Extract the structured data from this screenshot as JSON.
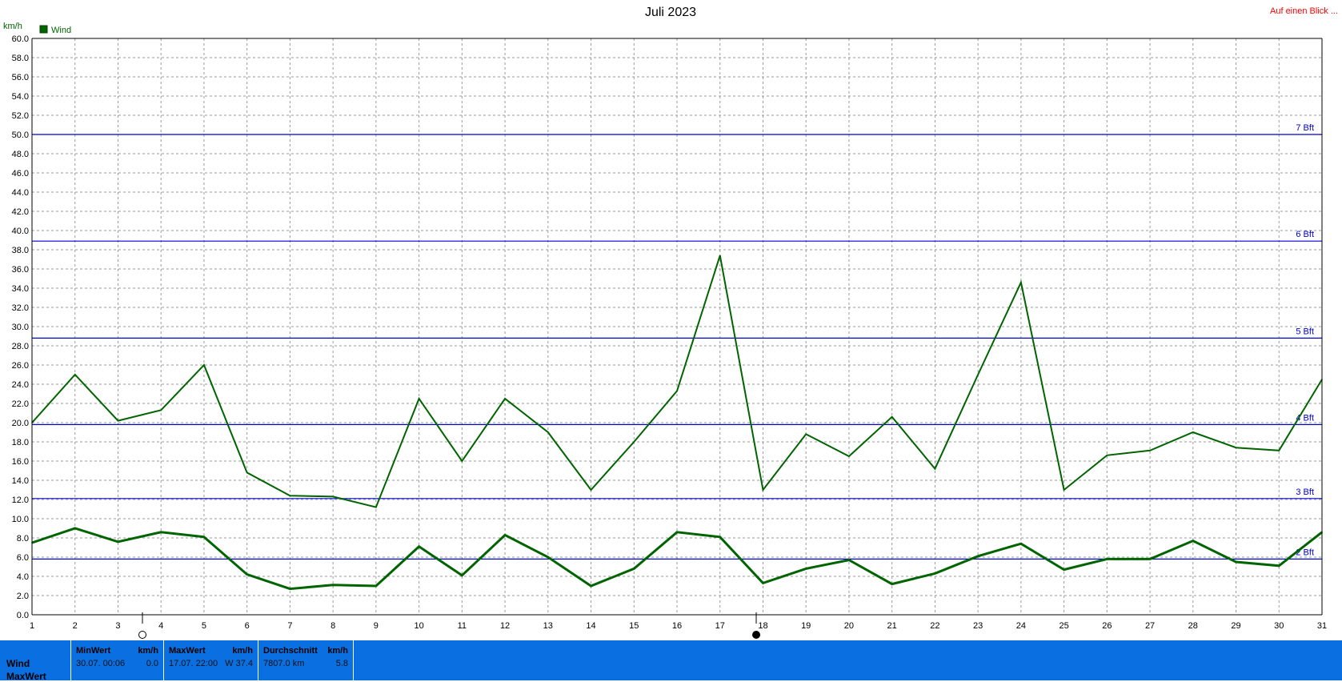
{
  "chart_data": {
    "type": "line",
    "title": "Juli 2023",
    "ylabel": "km/h",
    "ylim": [
      0,
      60
    ],
    "yticks": [
      "0.0",
      "2.0",
      "4.0",
      "6.0",
      "8.0",
      "10.0",
      "12.0",
      "14.0",
      "16.0",
      "18.0",
      "20.0",
      "22.0",
      "24.0",
      "26.0",
      "28.0",
      "30.0",
      "32.0",
      "34.0",
      "36.0",
      "38.0",
      "40.0",
      "42.0",
      "44.0",
      "46.0",
      "48.0",
      "50.0",
      "52.0",
      "54.0",
      "56.0",
      "58.0",
      "60.0"
    ],
    "x": [
      1,
      2,
      3,
      4,
      5,
      6,
      7,
      8,
      9,
      10,
      11,
      12,
      13,
      14,
      15,
      16,
      17,
      18,
      19,
      20,
      21,
      22,
      23,
      24,
      25,
      26,
      27,
      28,
      29,
      30,
      31
    ],
    "grid": true,
    "legend": [
      {
        "name": "Wind",
        "color": "#006400",
        "placement": "top-left"
      }
    ],
    "series": [
      {
        "name": "Wind",
        "kind": "gusts",
        "color": "#006400",
        "values": [
          20.0,
          25.0,
          20.2,
          21.3,
          26.0,
          14.8,
          12.4,
          12.3,
          11.2,
          22.5,
          16.0,
          22.5,
          19.0,
          13.0,
          18.0,
          23.3,
          37.4,
          13.0,
          18.8,
          16.5,
          20.6,
          15.2,
          25.0,
          34.6,
          13.0,
          16.6,
          17.1,
          19.0,
          17.4,
          17.1,
          24.5
        ]
      },
      {
        "name": "Wind",
        "kind": "average",
        "color": "#006400",
        "values": [
          7.5,
          9.0,
          7.6,
          8.6,
          8.1,
          4.2,
          2.7,
          3.1,
          3.0,
          7.1,
          4.1,
          8.3,
          6.0,
          3.0,
          4.8,
          8.6,
          8.1,
          3.3,
          4.8,
          5.7,
          3.2,
          4.3,
          6.1,
          7.4,
          4.7,
          5.8,
          5.8,
          7.7,
          5.5,
          5.1,
          8.6
        ]
      }
    ],
    "reference_lines": [
      {
        "label": "2 Bft",
        "value": 5.8,
        "color": "#0000cc"
      },
      {
        "label": "3 Bft",
        "value": 12.1,
        "color": "#0000cc"
      },
      {
        "label": "4 Bft",
        "value": 19.8,
        "color": "#0000cc"
      },
      {
        "label": "5 Bft",
        "value": 28.8,
        "color": "#0000cc"
      },
      {
        "label": "6 Bft",
        "value": 38.9,
        "color": "#0000cc"
      },
      {
        "label": "7 Bft",
        "value": 50.0,
        "color": "#0000cc"
      }
    ]
  },
  "header": {
    "corner_link": "Auf einen Blick ...",
    "corner_link_color": "#ff0000"
  },
  "stats": {
    "row_labels": [
      "Wind",
      "MaxWert"
    ],
    "min": {
      "header": "MinWert",
      "unit": "km/h",
      "date": "30.07.  00:06",
      "value": "0.0"
    },
    "max": {
      "header": "MaxWert",
      "unit": "km/h",
      "date": "17.07.  22:00",
      "value": "W 37.4"
    },
    "avg": {
      "header": "Durchschnitt",
      "unit": "km/h",
      "date": "7807.0 km",
      "value": "5.8"
    },
    "bar_color": "#0a6fe0"
  }
}
